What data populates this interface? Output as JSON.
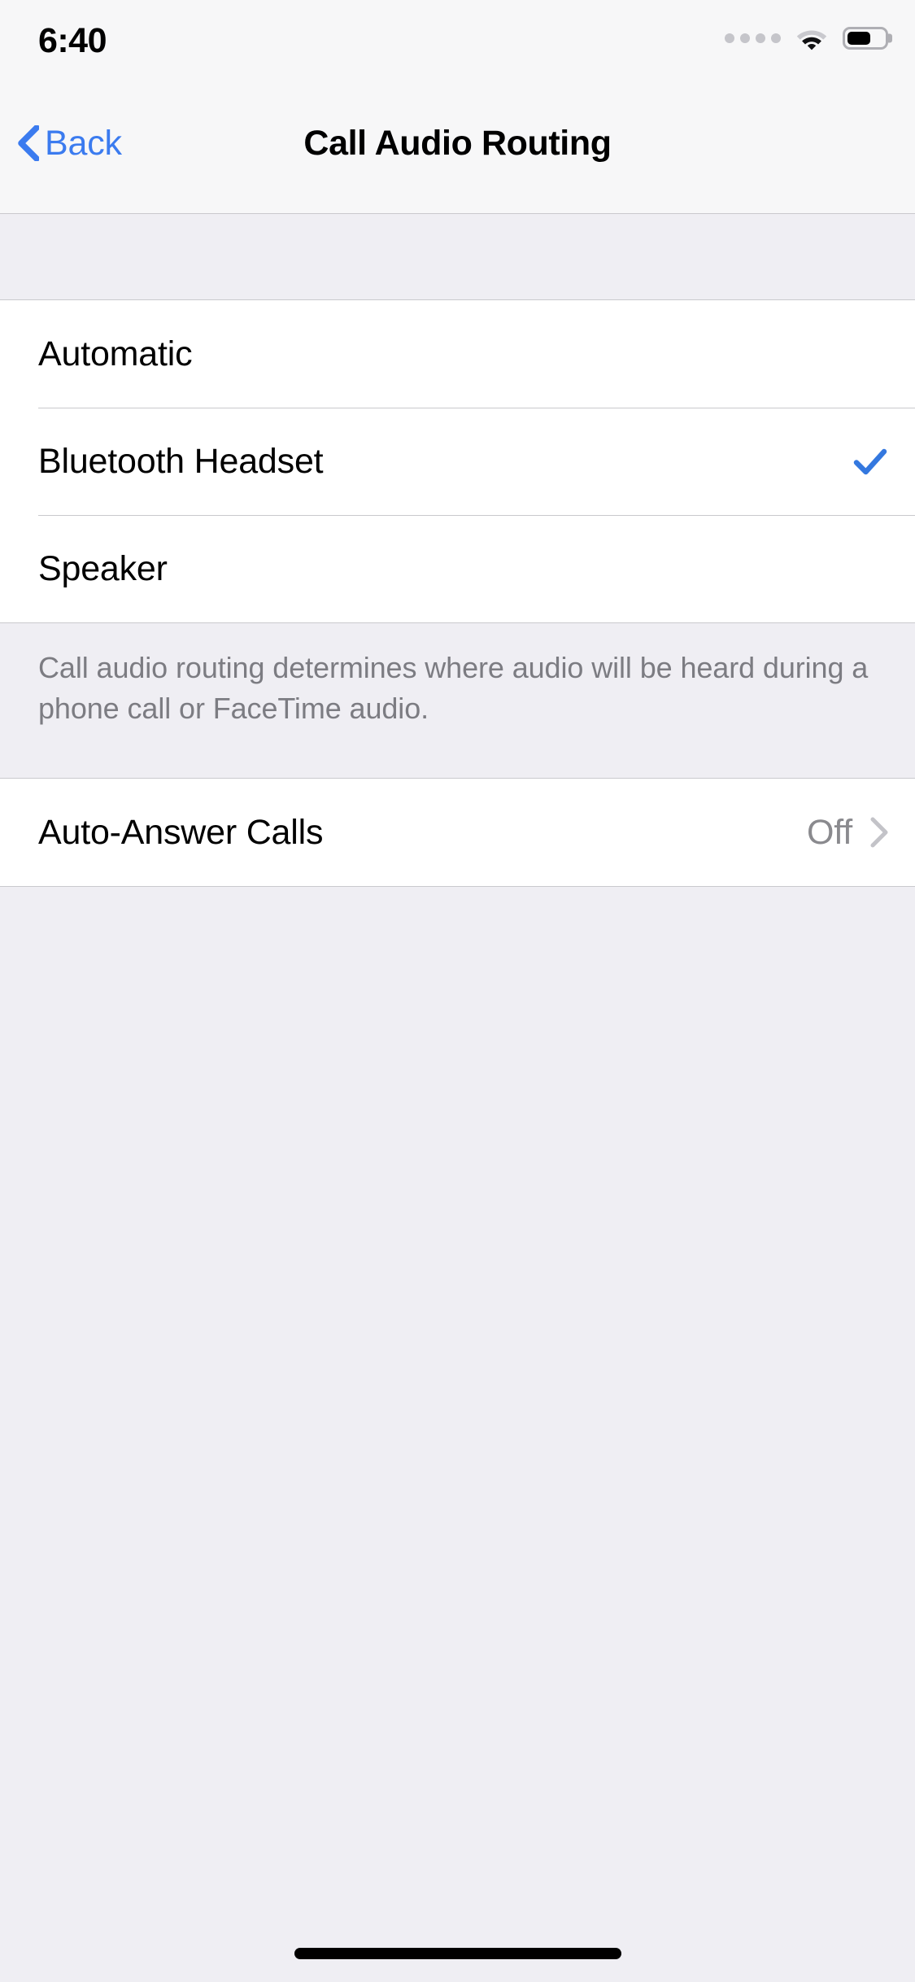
{
  "status_bar": {
    "time": "6:40",
    "cellular_icon": "cellular-dots-icon",
    "cellular_dots": 4,
    "wifi_icon": "wifi-icon",
    "battery_icon": "battery-icon",
    "battery_level_percent": 55
  },
  "nav_bar": {
    "back_label": "Back",
    "back_icon": "chevron-left-icon",
    "title": "Call Audio Routing"
  },
  "routing_group": {
    "rows": [
      {
        "label": "Automatic",
        "selected": false
      },
      {
        "label": "Bluetooth Headset",
        "selected": true
      },
      {
        "label": "Speaker",
        "selected": false
      }
    ],
    "check_icon": "checkmark-icon",
    "footer": "Call audio routing determines where audio will be heard during a phone call or FaceTime audio."
  },
  "auto_answer_group": {
    "row": {
      "label": "Auto-Answer Calls",
      "value": "Off",
      "disclosure_icon": "chevron-right-icon"
    }
  },
  "home_indicator": "home-indicator",
  "colors": {
    "accent_blue": "#3B7BEF",
    "check_blue": "#3478DF",
    "page_background": "#EFEEF3",
    "bar_background": "#F7F7F8",
    "row_background": "#FFFFFF",
    "separator": "#C9C9CD",
    "secondary_text": "#8A8A8E",
    "footer_text": "#7C7C82",
    "chevron_gray": "#C3C3C8"
  }
}
